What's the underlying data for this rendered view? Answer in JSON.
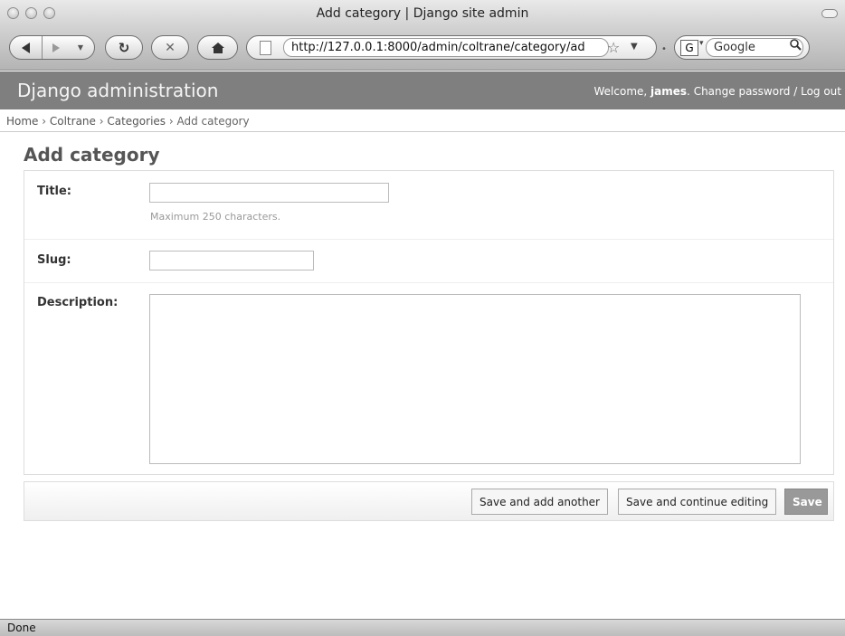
{
  "window": {
    "title": "Add category | Django site admin"
  },
  "browser": {
    "url": "http://127.0.0.1:8000/admin/coltrane/category/ad",
    "search_placeholder": "Google",
    "search_engine_glyph": "G",
    "status": "Done"
  },
  "header": {
    "brand": "Django administration",
    "welcome": "Welcome, ",
    "username": "james",
    "after_user": ". ",
    "change_password": "Change password",
    "separator": " / ",
    "logout": "Log out"
  },
  "breadcrumbs": {
    "home": "Home",
    "app": "Coltrane",
    "model": "Categories",
    "current": "Add category",
    "sep": " › "
  },
  "page": {
    "title": "Add category"
  },
  "form": {
    "title": {
      "label": "Title:",
      "value": "",
      "help": "Maximum 250 characters."
    },
    "slug": {
      "label": "Slug:",
      "value": ""
    },
    "description": {
      "label": "Description:",
      "value": ""
    }
  },
  "actions": {
    "save_add_another": "Save and add another",
    "save_continue": "Save and continue editing",
    "save": "Save"
  }
}
